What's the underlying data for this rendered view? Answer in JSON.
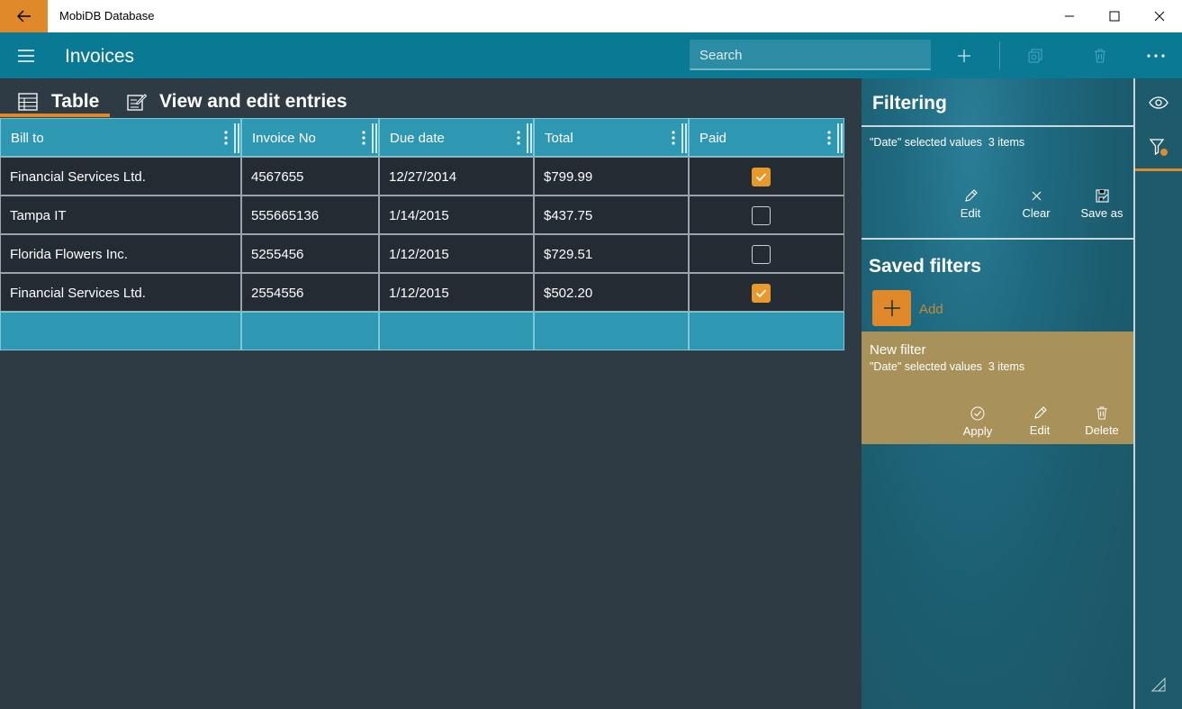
{
  "window": {
    "title": "MobiDB Database"
  },
  "header": {
    "title": "Invoices",
    "search_placeholder": "Search"
  },
  "tabs": [
    {
      "label": "Table",
      "active": true
    },
    {
      "label": "View and edit entries",
      "active": false
    }
  ],
  "table": {
    "columns": [
      "Bill to",
      "Invoice No",
      "Due date",
      "Total",
      "Paid"
    ],
    "rows": [
      {
        "bill_to": "Financial Services Ltd.",
        "invoice_no": "4567655",
        "due_date": "12/27/2014",
        "total": "$799.99",
        "paid": true
      },
      {
        "bill_to": "Tampa IT",
        "invoice_no": "555665136",
        "due_date": "1/14/2015",
        "total": "$437.75",
        "paid": false
      },
      {
        "bill_to": "Florida Flowers Inc.",
        "invoice_no": "5255456",
        "due_date": "1/12/2015",
        "total": "$729.51",
        "paid": false
      },
      {
        "bill_to": "Financial Services Ltd.",
        "invoice_no": "2554556",
        "due_date": "1/12/2015",
        "total": "$502.20",
        "paid": true
      }
    ]
  },
  "filtering": {
    "title": "Filtering",
    "current": {
      "field": "\"Date\" selected values",
      "count": "3 items"
    },
    "actions": {
      "edit": "Edit",
      "clear": "Clear",
      "save_as": "Save as"
    }
  },
  "saved_filters": {
    "title": "Saved filters",
    "add_label": "Add",
    "items": [
      {
        "name": "New filter",
        "field": "\"Date\" selected values",
        "count": "3 items",
        "actions": {
          "apply": "Apply",
          "edit": "Edit",
          "delete": "Delete"
        }
      }
    ]
  },
  "colors": {
    "accent": "#e0892a",
    "header": "#0a7a94",
    "table_header": "#2e97b1",
    "card": "#a8925a"
  },
  "icons": [
    "back-arrow-icon",
    "minimize-icon",
    "maximize-icon",
    "close-icon",
    "hamburger-icon",
    "plus-icon",
    "copy-icon",
    "trash-icon",
    "more-icon",
    "table-icon",
    "edit-entries-icon",
    "pencil-icon",
    "clear-x-icon",
    "save-as-icon",
    "checkmark-circle-icon",
    "eye-icon",
    "filter-icon",
    "resize-grip-icon"
  ]
}
